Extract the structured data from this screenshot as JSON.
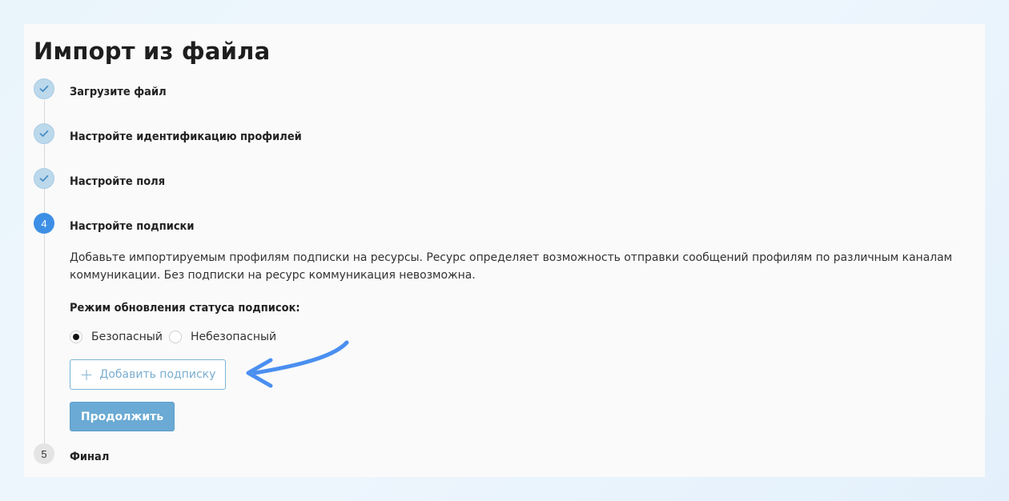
{
  "page": {
    "title": "Импорт из файла"
  },
  "steps": [
    {
      "label": "Загрузите файл",
      "state": "done",
      "icon": "check-icon"
    },
    {
      "label": "Настройте идентификацию профилей",
      "state": "done",
      "icon": "check-icon"
    },
    {
      "label": "Настройте поля",
      "state": "done",
      "icon": "check-icon"
    },
    {
      "label": "Настройте подписки",
      "state": "active",
      "number": "4"
    },
    {
      "label": "Финал",
      "state": "pending",
      "number": "5"
    }
  ],
  "subscriptions": {
    "description": "Добавьте импортируемым профилям подписки на ресурсы. Ресурс определяет возможность отправки сообщений профилям по различным каналам коммуникации. Без подписки на ресурс коммуникация невозможна.",
    "mode_label": "Режим обновления статуса подписок:",
    "mode_options": [
      {
        "label": "Безопасный",
        "selected": true
      },
      {
        "label": "Небезопасный",
        "selected": false
      }
    ],
    "add_button": {
      "icon": "plus-icon",
      "label": "Добавить подписку"
    },
    "continue_button": "Продолжить"
  },
  "colors": {
    "active_step": "#3d8fe6",
    "done_step": "#bcd9ec",
    "primary_button": "#6aaad4",
    "annotation_arrow": "#4a8ff0"
  }
}
